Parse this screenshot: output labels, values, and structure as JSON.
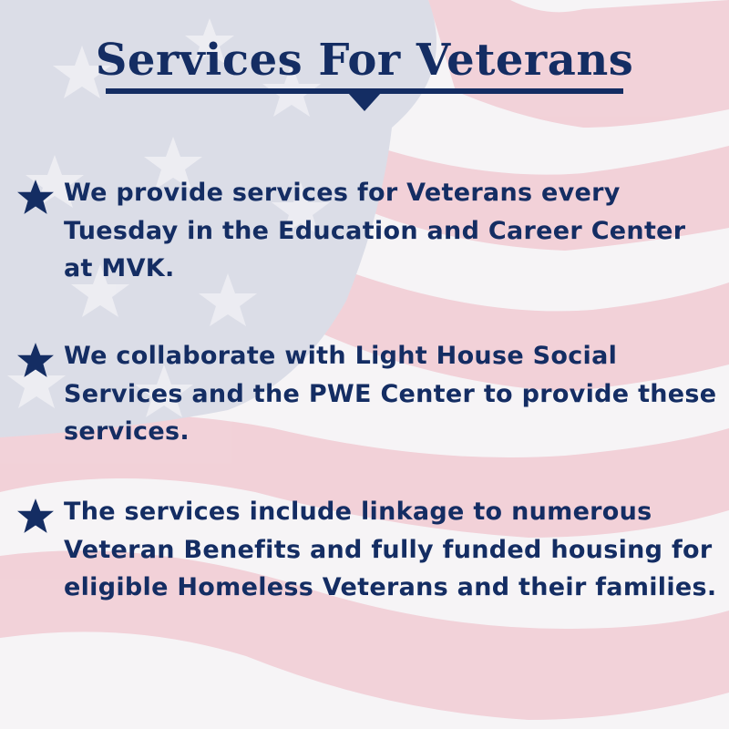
{
  "title": "Services For Veterans",
  "items": [
    {
      "icon": "star-icon",
      "text": "We provide services for Veterans every Tuesday in the Education and Career Center at MVK."
    },
    {
      "icon": "star-icon",
      "text": "We collaborate with Light House Social Services and the PWE Center to provide these services."
    },
    {
      "icon": "star-icon",
      "text": "The services include linkage to numerous Veteran Benefits and fully funded housing for eligible Homeless Veterans and their families."
    }
  ],
  "colors": {
    "text": "#142d63",
    "stripe_red": "#efc5cf",
    "canton_blue": "#d4d6e2",
    "background": "#f4f2f5"
  }
}
